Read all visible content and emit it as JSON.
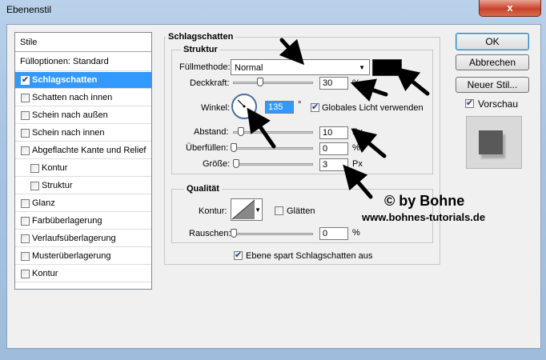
{
  "window": {
    "title": "Ebenenstil",
    "close_glyph": "x"
  },
  "styles_list": {
    "header": "Stile",
    "blend_options": "Fülloptionen: Standard",
    "items": [
      {
        "label": "Schlagschatten",
        "checked": true,
        "selected": true,
        "indent": false
      },
      {
        "label": "Schatten nach innen",
        "checked": false,
        "selected": false,
        "indent": false
      },
      {
        "label": "Schein nach außen",
        "checked": false,
        "selected": false,
        "indent": false
      },
      {
        "label": "Schein nach innen",
        "checked": false,
        "selected": false,
        "indent": false
      },
      {
        "label": "Abgeflachte Kante und Relief",
        "checked": false,
        "selected": false,
        "indent": false
      },
      {
        "label": "Kontur",
        "checked": false,
        "selected": false,
        "indent": true
      },
      {
        "label": "Struktur",
        "checked": false,
        "selected": false,
        "indent": true
      },
      {
        "label": "Glanz",
        "checked": false,
        "selected": false,
        "indent": false
      },
      {
        "label": "Farbüberlagerung",
        "checked": false,
        "selected": false,
        "indent": false
      },
      {
        "label": "Verlaufsüberlagerung",
        "checked": false,
        "selected": false,
        "indent": false
      },
      {
        "label": "Musterüberlagerung",
        "checked": false,
        "selected": false,
        "indent": false
      },
      {
        "label": "Kontur",
        "checked": false,
        "selected": false,
        "indent": false
      }
    ]
  },
  "drop_shadow": {
    "section_title": "Schlagschatten",
    "structure": {
      "title": "Struktur",
      "blend_mode_label": "Füllmethode:",
      "blend_mode_value": "Normal",
      "shadow_color": "#000000",
      "opacity_label": "Deckkraft:",
      "opacity_value": "30",
      "opacity_level": 0.3,
      "opacity_unit": "%",
      "angle_label": "Winkel:",
      "angle_value": "135",
      "angle_unit": "°",
      "global_light_label": "Globales Licht verwenden",
      "global_light_checked": true,
      "distance_label": "Abstand:",
      "distance_value": "10",
      "distance_unit": "Px",
      "spread_label": "Überfüllen:",
      "spread_value": "0",
      "spread_unit": "%",
      "size_label": "Größe:",
      "size_value": "3",
      "size_unit": "Px"
    },
    "quality": {
      "title": "Qualität",
      "contour_label": "Kontur:",
      "antialias_label": "Glätten",
      "antialias_checked": false,
      "noise_label": "Rauschen:",
      "noise_value": "0",
      "noise_unit": "%"
    },
    "knockout_label": "Ebene spart Schlagschatten aus",
    "knockout_checked": true
  },
  "buttons": {
    "ok": "OK",
    "cancel": "Abbrechen",
    "new_style": "Neuer Stil...",
    "preview_label": "Vorschau",
    "preview_checked": true
  },
  "watermark": {
    "line1": "© by Bohne",
    "line2": "www.bohnes-tutorials.de"
  }
}
